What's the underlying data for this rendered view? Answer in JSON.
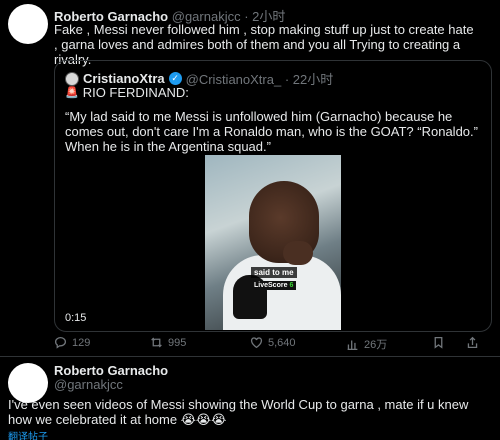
{
  "tweet1": {
    "name": "Roberto Garnacho",
    "handle": "@garnakjcc",
    "time": "· 2小时",
    "text": "Fake , Messi never followed him , stop making stuff up just to create hate , garna loves and admires both of them and you all Trying to creating a rivalry.",
    "quote": {
      "name": "CristianoXtra",
      "handle": "@CristianoXtra_ · 22小时",
      "speaker": "RIO FERDINAND:",
      "text": "“My lad said to me Messi is unfollowed him (Garnacho) because he comes out, don't care I'm a Ronaldo man, who is the GOAT? “Ronaldo.” When he is in the Argentina squad.”",
      "video": {
        "caption": "said to me",
        "badge": "LiveScore",
        "badge_num": "6",
        "duration": "0:15"
      }
    },
    "actions": {
      "replies": "129",
      "retweets": "995",
      "likes": "5,640",
      "views": "26万"
    }
  },
  "tweet2": {
    "name": "Roberto Garnacho",
    "handle": "@garnakjcc",
    "text": "I've even seen videos of Messi showing the World Cup to garna , mate if u knew how we celebrated it at home 😭😭😭",
    "translate": "翻译帖子"
  }
}
